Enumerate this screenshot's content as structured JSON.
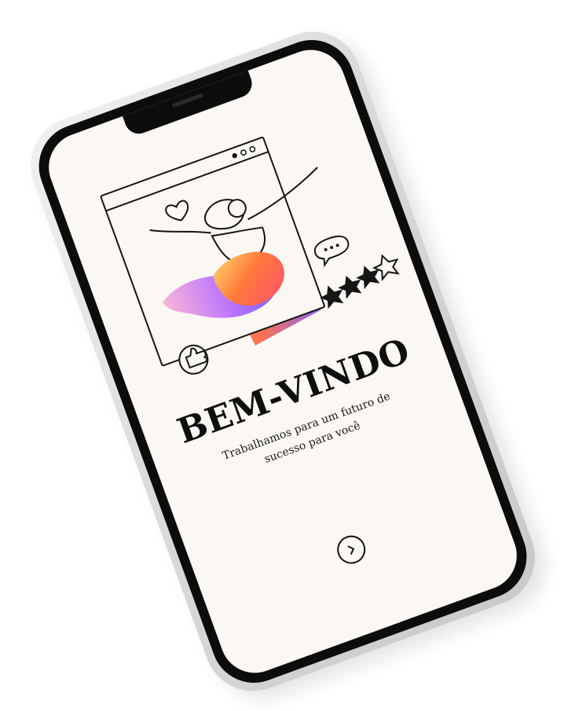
{
  "welcome": {
    "title": "BEM-VINDO",
    "subtitle": "Trabalhamos para um futuro de sucesso para você"
  },
  "navigation": {
    "next_icon": "chevron-right-icon"
  },
  "illustration": {
    "rating_stars_filled": 3,
    "rating_stars_total": 4
  },
  "colors": {
    "screen_background": "#fbf8f3",
    "text": "#0f0f0f",
    "gradient": [
      "#f6a94a",
      "#ff6a3d",
      "#c87be6",
      "#6a5bff"
    ]
  }
}
